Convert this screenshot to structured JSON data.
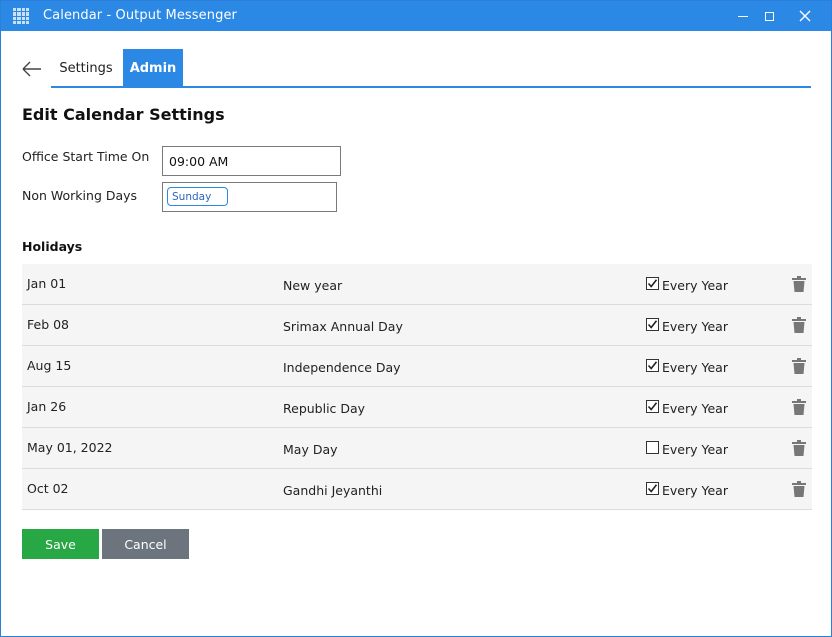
{
  "window": {
    "title": "Calendar - Output Messenger",
    "app_icon": "grid-icon",
    "accent_color": "#2b88e4"
  },
  "nav": {
    "back_icon": "arrow-left-icon",
    "tabs": [
      {
        "label": "Settings",
        "active": false
      },
      {
        "label": "Admin",
        "active": true
      }
    ]
  },
  "form": {
    "title": "Edit Calendar Settings",
    "office_start_label": "Office Start Time On",
    "office_start_value": "09:00 AM",
    "non_working_label": "Non Working Days",
    "non_working_days": [
      "Sunday"
    ]
  },
  "holidays": {
    "title": "Holidays",
    "every_year_label": "Every Year",
    "rows": [
      {
        "date": "Jan 01",
        "name": "New year",
        "every_year": true
      },
      {
        "date": "Feb 08",
        "name": "Srimax Annual Day",
        "every_year": true
      },
      {
        "date": "Aug 15",
        "name": "Independence Day",
        "every_year": true
      },
      {
        "date": "Jan 26",
        "name": "Republic Day",
        "every_year": true
      },
      {
        "date": "May 01, 2022",
        "name": "May Day",
        "every_year": false
      },
      {
        "date": "Oct 02",
        "name": "Gandhi Jeyanthi",
        "every_year": true
      }
    ]
  },
  "actions": {
    "save_label": "Save",
    "save_color": "#28a745",
    "cancel_label": "Cancel",
    "cancel_color": "#6c757d"
  }
}
